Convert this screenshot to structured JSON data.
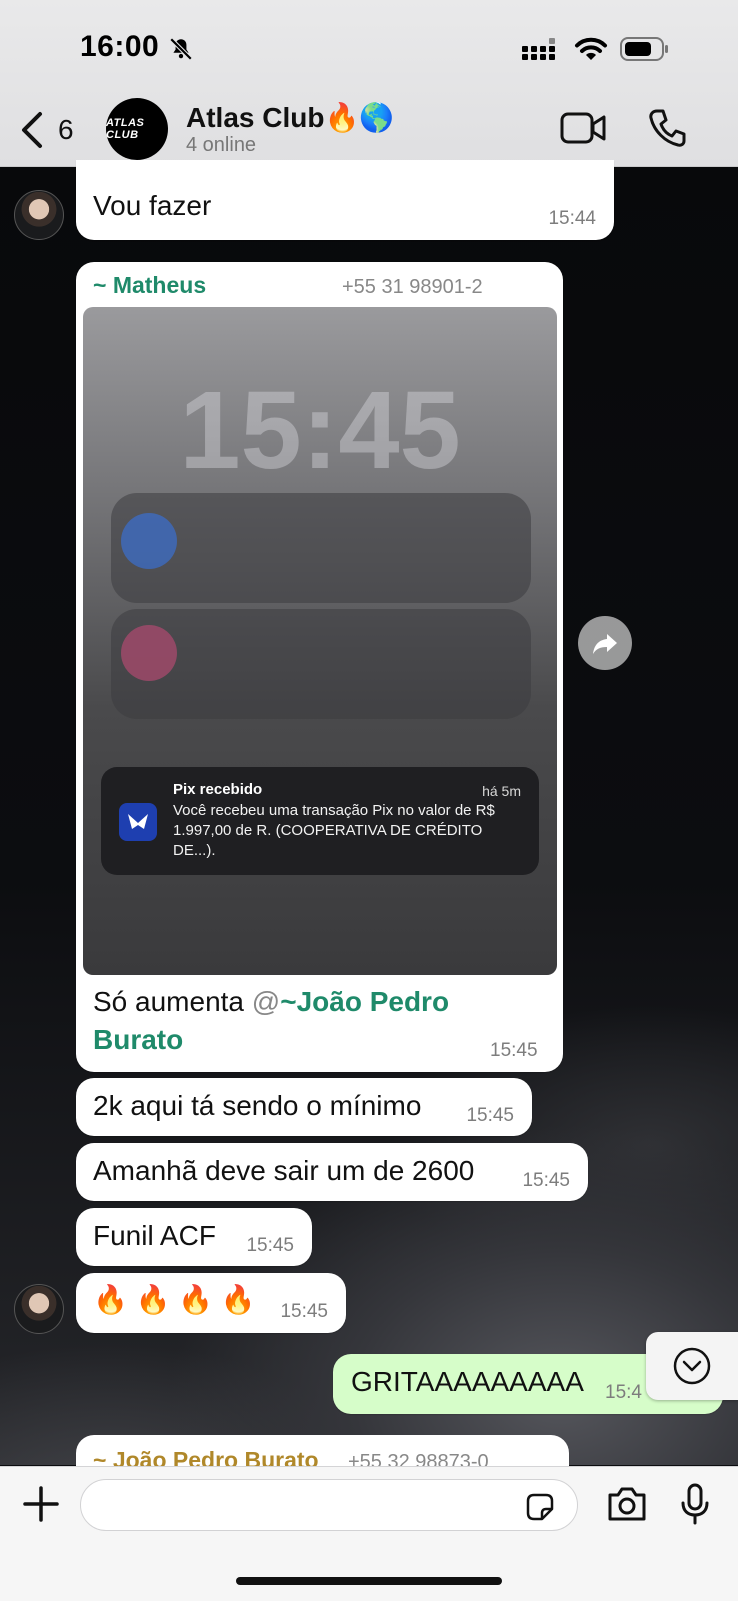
{
  "status_bar": {
    "time": "16:00"
  },
  "header": {
    "back_count": "6",
    "avatar_text": "ATLAS CLUB",
    "group_name": "Atlas Club🔥🌎",
    "subtitle": "4 online"
  },
  "messages": {
    "m1": {
      "text": "Vou fazer",
      "time": "15:44"
    },
    "m2": {
      "sender": "~ Matheus",
      "phone": "+55 31 98901-2",
      "image": {
        "blur_time": "15:45",
        "notification": {
          "title": "Pix recebido",
          "time": "há 5m",
          "body": "Você recebeu uma transação Pix no valor de R$ 1.997,00 de R. (COOPERATIVA DE CRÉDITO DE...)."
        }
      },
      "caption_prefix": "Só aumenta ",
      "caption_at": "@",
      "caption_mention_1": "~João Pedro",
      "caption_mention_2": "Burato",
      "time": "15:45"
    },
    "m3": {
      "text": "2k aqui tá sendo o mínimo",
      "time": "15:45"
    },
    "m4": {
      "text": "Amanhã deve sair um de 2600",
      "time": "15:45"
    },
    "m5": {
      "text": "Funil ACF",
      "time": "15:45"
    },
    "m6": {
      "text": "🔥 🔥 🔥 🔥",
      "time": "15:45"
    },
    "m7": {
      "text": "GRITAAAAAAAAA",
      "time": "15:4"
    },
    "m8": {
      "sender": "~ João Pedro Burato",
      "phone": "+55 32 98873-0"
    }
  },
  "colors": {
    "incoming_bubble": "#ffffff",
    "outgoing_bubble": "#d6fdc9",
    "sender_green": "#1f8a6a",
    "sender_gold": "#b0882a"
  }
}
